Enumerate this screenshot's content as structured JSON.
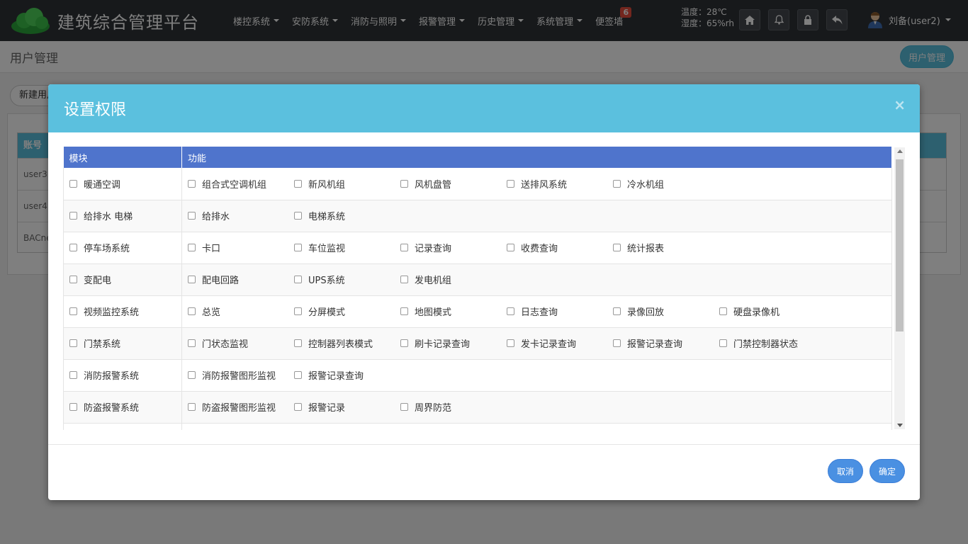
{
  "app": {
    "title": "建筑综合管理平台"
  },
  "nav": {
    "items": [
      {
        "label": "楼控系统"
      },
      {
        "label": "安防系统"
      },
      {
        "label": "消防与照明"
      },
      {
        "label": "报警管理"
      },
      {
        "label": "历史管理"
      },
      {
        "label": "系统管理"
      }
    ],
    "board": {
      "label": "便签墙",
      "badge": "6"
    }
  },
  "env": {
    "temperature": "温度：28℃",
    "humidity": "湿度：65%rh"
  },
  "user": {
    "name": "刘备(user2)"
  },
  "page": {
    "title": "用户管理",
    "header_button": "用户管理",
    "new_user_button": "新建用户",
    "table": {
      "header": "账号",
      "rows": [
        "user3",
        "user4",
        "BACnet"
      ]
    }
  },
  "modal": {
    "title": "设置权限",
    "close": "×",
    "columns": [
      "模块",
      "功能"
    ],
    "rows": [
      {
        "module": "暖通空调",
        "functions": [
          "组合式空调机组",
          "新风机组",
          "风机盘管",
          "送排风系统",
          "冷水机组"
        ]
      },
      {
        "module": "给排水 电梯",
        "functions": [
          "给排水",
          "电梯系统"
        ]
      },
      {
        "module": "停车场系统",
        "functions": [
          "卡口",
          "车位监视",
          "记录查询",
          "收费查询",
          "统计报表"
        ]
      },
      {
        "module": "变配电",
        "functions": [
          "配电回路",
          "UPS系统",
          "发电机组"
        ]
      },
      {
        "module": "视频监控系统",
        "functions": [
          "总览",
          "分屏模式",
          "地图模式",
          "日志查询",
          "录像回放",
          "硬盘录像机"
        ]
      },
      {
        "module": "门禁系统",
        "functions": [
          "门状态监视",
          "控制器列表模式",
          "刷卡记录查询",
          "发卡记录查询",
          "报警记录查询",
          "门禁控制器状态"
        ]
      },
      {
        "module": "消防报警系统",
        "functions": [
          "消防报警图形监视",
          "报警记录查询"
        ]
      },
      {
        "module": "防盗报警系统",
        "functions": [
          "防盗报警图形监视",
          "报警记录",
          "周界防范"
        ]
      },
      {
        "module": "",
        "functions": []
      }
    ],
    "cancel": "取消",
    "confirm": "确定"
  },
  "colors": {
    "header": "#5bc0de",
    "table_header": "#4f74cc",
    "button": "#4a90e2",
    "topbar": "#2f3337"
  }
}
